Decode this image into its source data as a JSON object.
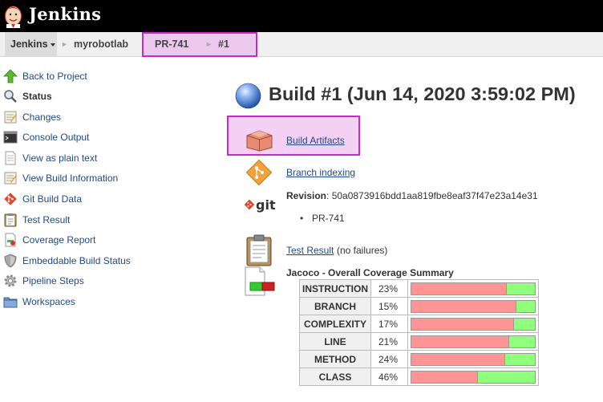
{
  "header": {
    "title": "Jenkins"
  },
  "breadcrumb": [
    "Jenkins",
    "myrobotlab",
    "PR-741",
    "#1"
  ],
  "sidebar": {
    "items": [
      {
        "label": "Back to Project",
        "icon": "up-arrow-icon"
      },
      {
        "label": "Status",
        "icon": "magnifier-icon"
      },
      {
        "label": "Changes",
        "icon": "notepad-icon"
      },
      {
        "label": "Console Output",
        "icon": "terminal-icon"
      },
      {
        "label": "View as plain text",
        "icon": "document-icon"
      },
      {
        "label": "View Build Information",
        "icon": "notepad-icon"
      },
      {
        "label": "Git Build Data",
        "icon": "git-icon"
      },
      {
        "label": "Test Result",
        "icon": "clipboard-icon"
      },
      {
        "label": "Coverage Report",
        "icon": "coverage-icon"
      },
      {
        "label": "Embeddable Build Status",
        "icon": "shield-icon"
      },
      {
        "label": "Pipeline Steps",
        "icon": "gear-icon"
      },
      {
        "label": "Workspaces",
        "icon": "folder-icon"
      }
    ]
  },
  "build": {
    "title": "Build #1 (Jun 14, 2020 3:59:02 PM)",
    "status_color": "#4a7fd3",
    "artifacts_label": "Build Artifacts",
    "branch_indexing_label": "Branch indexing",
    "git_logo_text": "git",
    "revision_label": "Revision",
    "revision": "50a0873916bdd1aa819fbe8eaf37f47e23a14e31",
    "branch": "PR-741",
    "test_result_label": "Test Result",
    "test_result_note": "(no failures)"
  },
  "coverage": {
    "title": "Jacoco - Overall Coverage Summary",
    "covered_color": "#8fff7c",
    "missed_color": "#ff9494",
    "rows": [
      {
        "name": "INSTRUCTION",
        "percent": "23%",
        "covered": 23
      },
      {
        "name": "BRANCH",
        "percent": "15%",
        "covered": 15
      },
      {
        "name": "COMPLEXITY",
        "percent": "17%",
        "covered": 17
      },
      {
        "name": "LINE",
        "percent": "21%",
        "covered": 21
      },
      {
        "name": "METHOD",
        "percent": "24%",
        "covered": 24
      },
      {
        "name": "CLASS",
        "percent": "46%",
        "covered": 46
      }
    ]
  }
}
